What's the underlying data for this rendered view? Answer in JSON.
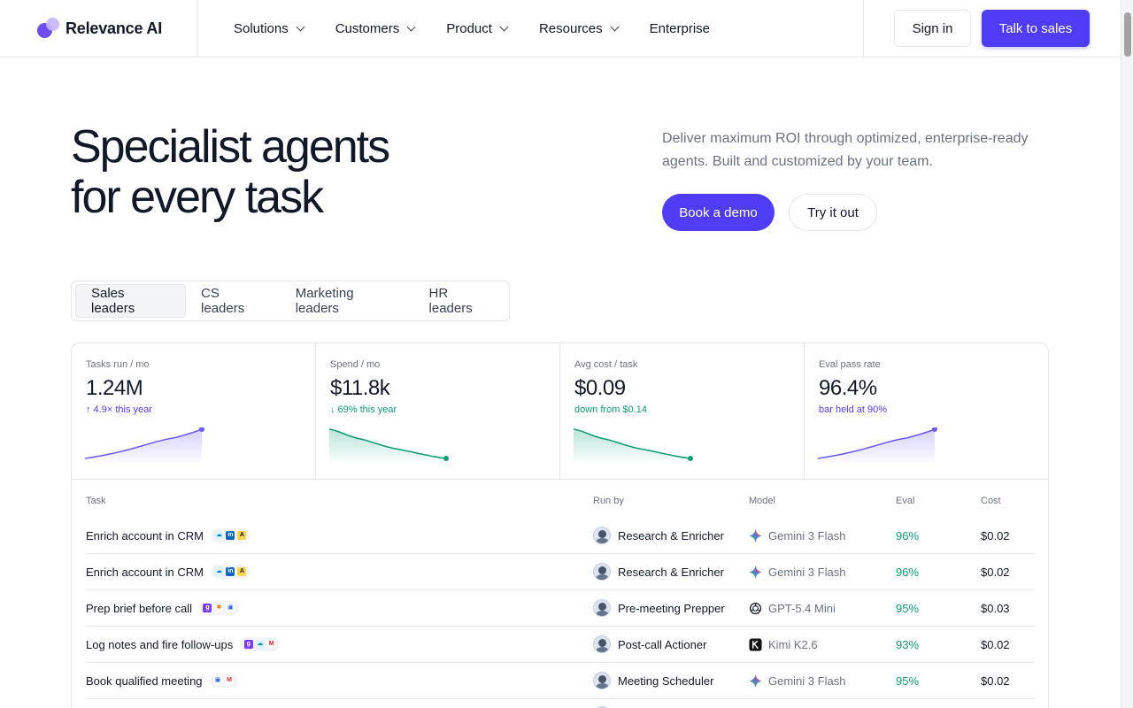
{
  "brand": {
    "name": "Relevance AI",
    "primary": "#4f3cf6",
    "positive": "#0f9d76"
  },
  "nav": {
    "items": [
      {
        "label": "Solutions",
        "has_dropdown": true
      },
      {
        "label": "Customers",
        "has_dropdown": true
      },
      {
        "label": "Product",
        "has_dropdown": true
      },
      {
        "label": "Resources",
        "has_dropdown": true
      },
      {
        "label": "Enterprise",
        "has_dropdown": false
      }
    ],
    "sign_in": "Sign in",
    "cta": "Talk to sales"
  },
  "hero": {
    "title_line1": "Specialist agents",
    "title_line2": "for every task",
    "subtitle": "Deliver maximum ROI through optimized, enterprise-ready agents. Built and customized by your team.",
    "primary_button": "Book a demo",
    "secondary_button": "Try it out"
  },
  "tabs": {
    "items": [
      "Sales leaders",
      "CS leaders",
      "Marketing leaders",
      "HR leaders"
    ],
    "active": "Sales leaders"
  },
  "stats": [
    {
      "label": "Tasks run / mo",
      "value": "1.24M",
      "delta": "↑ 4.9× this year",
      "delta_color": "#4f3cf6",
      "trend": "up",
      "spark_color": "#6d5cf6"
    },
    {
      "label": "Spend / mo",
      "value": "$11.8k",
      "delta": "↓ 69% this year",
      "delta_color": "#0f9d76",
      "trend": "down",
      "spark_color": "#0f9d76"
    },
    {
      "label": "Avg cost / task",
      "value": "$0.09",
      "delta": "down from $0.14",
      "delta_color": "#0f9d76",
      "trend": "down",
      "spark_color": "#0f9d76"
    },
    {
      "label": "Eval pass rate",
      "value": "96.4%",
      "delta": "bar held at 90%",
      "delta_color": "#4f3cf6",
      "trend": "up",
      "spark_color": "#6d5cf6"
    }
  ],
  "table": {
    "headers": {
      "task": "Task",
      "run_by": "Run by",
      "model": "Model",
      "eval": "Eval",
      "cost": "Cost"
    },
    "rows": [
      {
        "task": "Enrich account in CRM",
        "tools": [
          "salesforce",
          "linkedin",
          "apollo"
        ],
        "run_by": "Research & Enricher",
        "model": "Gemini 3 Flash",
        "model_icon": "gemini-icon",
        "eval": "96%",
        "cost": "$0.02"
      },
      {
        "task": "Enrich account in CRM",
        "tools": [
          "salesforce",
          "linkedin",
          "apollo"
        ],
        "run_by": "Research & Enricher",
        "model": "Gemini 3 Flash",
        "model_icon": "gemini-icon",
        "eval": "96%",
        "cost": "$0.02"
      },
      {
        "task": "Prep brief before call",
        "tools": [
          "gong",
          "hubspot",
          "calendar"
        ],
        "run_by": "Pre-meeting Prepper",
        "model": "GPT-5.4 Mini",
        "model_icon": "openai-icon",
        "eval": "95%",
        "cost": "$0.03"
      },
      {
        "task": "Log notes and fire follow-ups",
        "tools": [
          "gong",
          "salesforce",
          "gmail"
        ],
        "run_by": "Post-call Actioner",
        "model": "Kimi K2.6",
        "model_icon": "kimi-icon",
        "eval": "93%",
        "cost": "$0.02"
      },
      {
        "task": "Book qualified meeting",
        "tools": [
          "calendar",
          "gmail"
        ],
        "run_by": "Meeting Scheduler",
        "model": "Gemini 3 Flash",
        "model_icon": "gemini-icon",
        "eval": "95%",
        "cost": "$0.02"
      }
    ]
  }
}
